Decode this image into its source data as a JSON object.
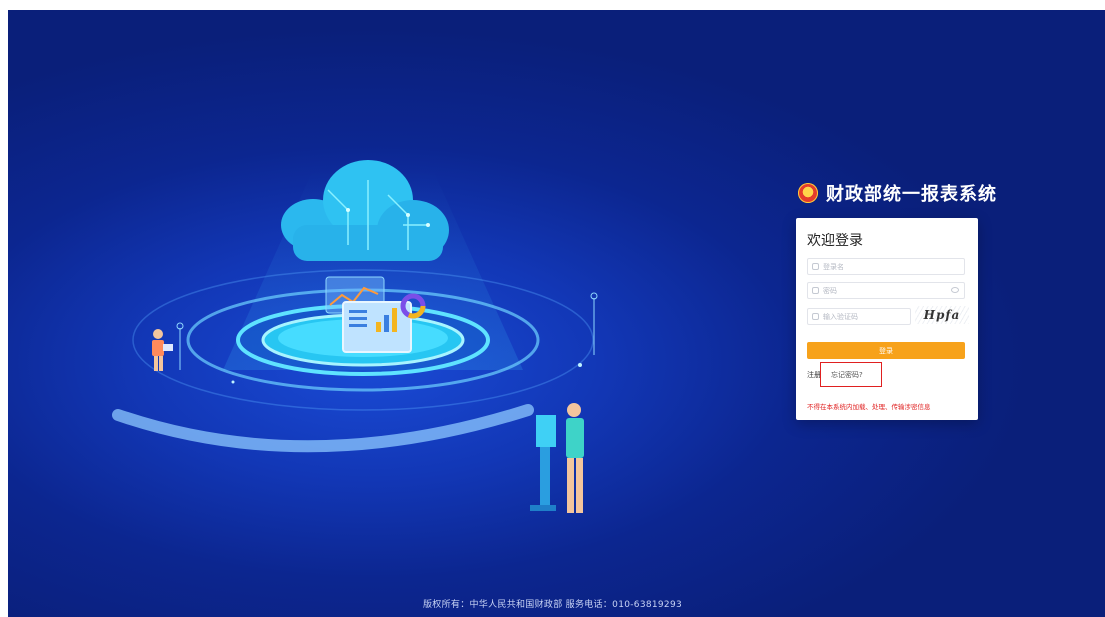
{
  "brand": {
    "emblem_icon": "national-emblem-icon",
    "title": "财政部统一报表系统"
  },
  "login": {
    "welcome": "欢迎登录",
    "username_placeholder": "登录名",
    "password_placeholder": "密码",
    "captcha_placeholder": "输入验证码",
    "captcha_image_text": "Hpfa",
    "login_button": "登录",
    "register_link": "注册",
    "forgot_link": "忘记密码?",
    "warning": "不得在本系统内加载、处理、传输涉密信息"
  },
  "footer": {
    "copyright": "版权所有：中华人民共和国财政部 服务电话：010-63819293"
  },
  "colors": {
    "background": "#1237b6",
    "accent_button": "#f7a21b",
    "warning": "#e02020",
    "highlight": "#e02020"
  }
}
